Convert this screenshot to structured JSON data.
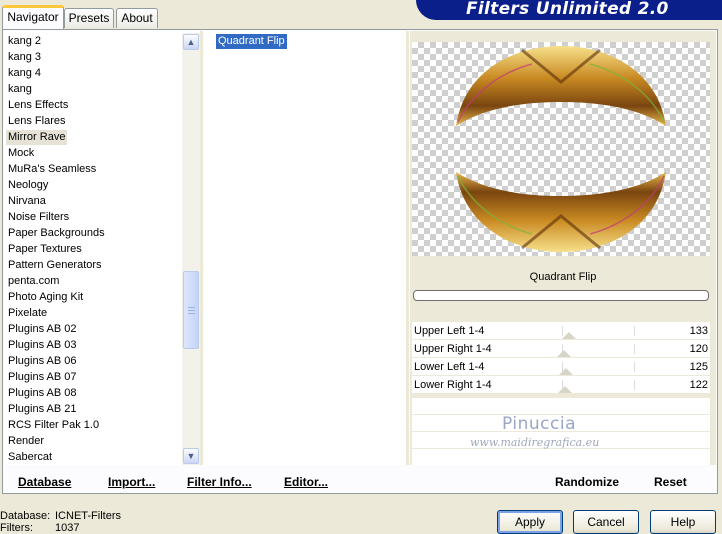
{
  "tabs": [
    "Navigator",
    "Presets",
    "About"
  ],
  "app_title": "Filters Unlimited 2.0",
  "categories": [
    "kang 2",
    "kang 3",
    "kang 4",
    "kang",
    "Lens Effects",
    "Lens Flares",
    "Mirror Rave",
    "Mock",
    "MuRa's Seamless",
    "Neology",
    "Nirvana",
    "Noise Filters",
    "Paper Backgrounds",
    "Paper Textures",
    "Pattern Generators",
    "penta.com",
    "Photo Aging Kit",
    "Pixelate",
    "Plugins AB 02",
    "Plugins AB 03",
    "Plugins AB 06",
    "Plugins AB 07",
    "Plugins AB 08",
    "Plugins AB 21",
    "RCS Filter Pak 1.0",
    "Render",
    "Sabercat"
  ],
  "selected_category": "Mirror Rave",
  "filter_item": "Quadrant Flip",
  "preview_label": "Quadrant Flip",
  "sliders": [
    {
      "label": "Upper Left 1-4",
      "value": 133
    },
    {
      "label": "Upper Right 1-4",
      "value": 120
    },
    {
      "label": "Lower Left 1-4",
      "value": 125
    },
    {
      "label": "Lower Right 1-4",
      "value": 122
    }
  ],
  "watermark": {
    "name": "Pinuccia",
    "url": "www.maidiregrafica.eu"
  },
  "links": {
    "database": "Database",
    "import": "Import...",
    "filter_info": "Filter Info...",
    "editor": "Editor...",
    "randomize": "Randomize",
    "reset": "Reset"
  },
  "info": {
    "database_label": "Database:",
    "database_value": "ICNET-Filters",
    "filters_label": "Filters:",
    "filters_value": "1037"
  },
  "buttons": {
    "apply": "Apply",
    "cancel": "Cancel",
    "help": "Help"
  },
  "colors": {
    "selection": "#316ac5",
    "banner": "#0a1f8a",
    "window": "#ece9d8"
  }
}
